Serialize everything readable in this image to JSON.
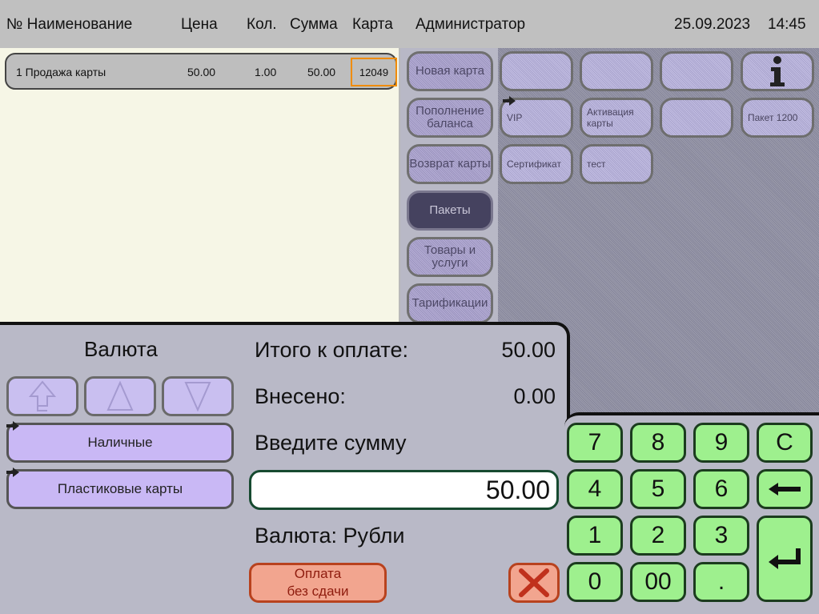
{
  "header": {
    "col_no_name": "№ Наименование",
    "col_price": "Цена",
    "col_qty": "Кол.",
    "col_sum": "Сумма",
    "col_card": "Карта",
    "user": "Администратор",
    "date": "25.09.2023",
    "time": "14:45"
  },
  "order": {
    "items": [
      {
        "name": "1 Продажа карты",
        "price": "50.00",
        "qty": "1.00",
        "sum": "50.00",
        "card": "12049"
      }
    ]
  },
  "categories": [
    {
      "label": "Новая карта",
      "active": false
    },
    {
      "label": "Пополнение баланса",
      "active": false
    },
    {
      "label": "Возврат карты",
      "active": false
    },
    {
      "label": "Пакеты",
      "active": true
    },
    {
      "label": "Товары и услуги",
      "active": false
    },
    {
      "label": "Тарификации",
      "active": false
    }
  ],
  "products": [
    {
      "label": ""
    },
    {
      "label": ""
    },
    {
      "label": ""
    },
    {
      "label": "",
      "icon": "info-icon"
    },
    {
      "label": "VIP"
    },
    {
      "label": "Активация карты"
    },
    {
      "label": ""
    },
    {
      "label": "Пакет 1200"
    },
    {
      "label": "Сертификат"
    },
    {
      "label": "тест"
    }
  ],
  "payment": {
    "currency_title": "Валюта",
    "total_label": "Итого к оплате:",
    "total_value": "50.00",
    "paid_label": "Внесено:",
    "paid_value": "0.00",
    "enter_label": "Введите сумму",
    "amount": "50.00",
    "currency_line": "Валюта: Рубли",
    "methods": [
      "Наличные",
      "Пластиковые карты"
    ],
    "no_change_label": "Оплата\nбез сдачи"
  },
  "keypad": {
    "keys": [
      "7",
      "8",
      "9",
      "C",
      "4",
      "5",
      "6",
      "1",
      "2",
      "3",
      "0",
      "00",
      "."
    ]
  },
  "colors": {
    "keypad_green": "#9ef08e",
    "pay_method_purple": "#c9b8f5",
    "alert_orange": "#f2a58f",
    "card_highlight": "#f08c00"
  }
}
